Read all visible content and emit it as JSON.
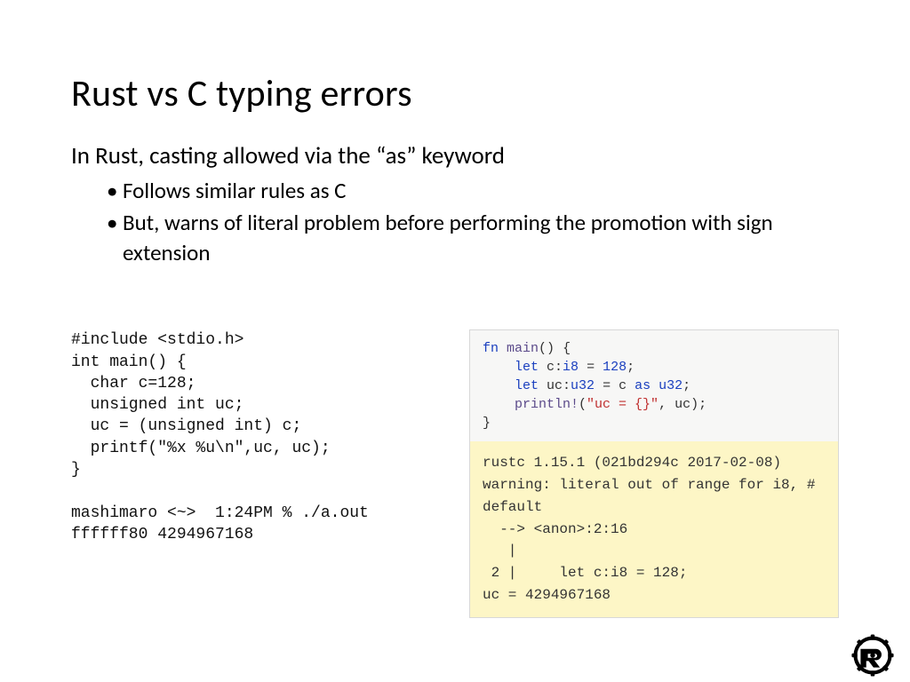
{
  "title": "Rust vs C typing errors",
  "lead": "In Rust, casting allowed via the “as” keyword",
  "bullets": {
    "b1": "Follows similar rules as C",
    "b2": "But, warns of literal problem before performing the promotion with sign extension"
  },
  "c_code": "#include <stdio.h>\nint main() {\n  char c=128;\n  unsigned int uc;\n  uc = (unsigned int) c;\n  printf(\"%x %u\\n\",uc, uc);\n}\n\nmashimaro <~>  1:24PM % ./a.out\nffffff80 4294967168",
  "rust": {
    "kw_fn": "fn",
    "fn_name": "main",
    "paren": "()",
    "brace_open": " {",
    "indent": "    ",
    "kw_let": "let",
    "var_c": " c:",
    "ty_i8": "i8",
    "eq": " = ",
    "num_128": "128",
    "semi": ";",
    "var_uc": " uc:",
    "ty_u32": "u32",
    "eq2": " = c ",
    "kw_as": "as",
    "sp": " ",
    "ty_u32b": "u32",
    "println": "println!",
    "str": "\"uc = {}\"",
    "rest": ", uc);",
    "brace_close": "}"
  },
  "rust_out": "rustc 1.15.1 (021bd294c 2017-02-08)\nwarning: literal out of range for i8, #\ndefault\n  --> <anon>:2:16\n   |\n 2 |     let c:i8 = 128;\nuc = 4294967168"
}
